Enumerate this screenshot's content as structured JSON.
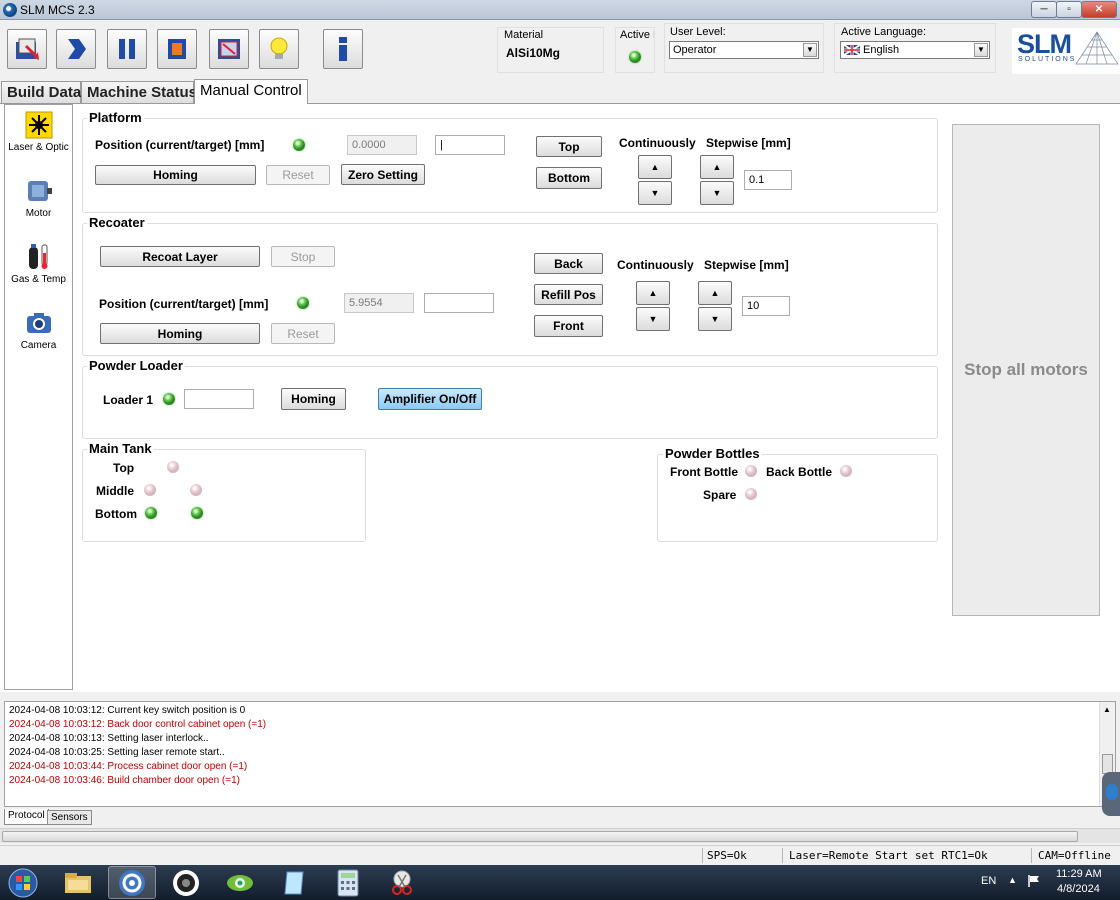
{
  "window": {
    "title": "SLM MCS 2.3",
    "minimize": "─",
    "maximize": "▫",
    "close": "✕"
  },
  "toolbar": {
    "buttons": [
      {
        "icon": "open-job-icon"
      },
      {
        "icon": "start-icon"
      },
      {
        "icon": "pause-icon"
      },
      {
        "icon": "stop-icon"
      },
      {
        "icon": "monitor-icon"
      },
      {
        "icon": "lightbulb-icon"
      },
      {
        "icon": "info-icon"
      }
    ],
    "material_label": "Material",
    "material_value": "AlSi10Mg",
    "active_l_label": "Active L",
    "user_level_label": "User Level:",
    "user_level_value": "Operator",
    "language_label": "Active Language:",
    "language_value": "English",
    "logo_text": "SLM",
    "logo_sub": "SOLUTIONS"
  },
  "tabs": [
    {
      "label": "Build Data"
    },
    {
      "label": "Machine Status"
    },
    {
      "label": "Manual Control"
    }
  ],
  "nav": [
    {
      "label": "Laser & Optic"
    },
    {
      "label": "Motor"
    },
    {
      "label": "Gas & Temp"
    },
    {
      "label": "Camera"
    }
  ],
  "platform": {
    "title": "Platform",
    "position_label": "Position (current/target) [mm]",
    "current": "0.0000",
    "target": "|",
    "homing": "Homing",
    "reset": "Reset",
    "zero": "Zero Setting",
    "top": "Top",
    "bottom": "Bottom",
    "continuously": "Continuously",
    "stepwise": "Stepwise [mm]",
    "step_value": "0.1"
  },
  "recoater": {
    "title": "Recoater",
    "recoat_layer": "Recoat Layer",
    "stop": "Stop",
    "position_label": "Position (current/target) [mm]",
    "current": "5.9554",
    "target": "",
    "homing": "Homing",
    "reset": "Reset",
    "back": "Back",
    "refill": "Refill Pos",
    "front": "Front",
    "continuously": "Continuously",
    "stepwise": "Stepwise [mm]",
    "step_value": "10"
  },
  "powder_loader": {
    "title": "Powder Loader",
    "loader_label": "Loader 1",
    "loader_value": "",
    "homing": "Homing",
    "amplifier": "Amplifier On/Off"
  },
  "main_tank": {
    "title": "Main Tank",
    "top": "Top",
    "middle": "Middle",
    "bottom": "Bottom"
  },
  "powder_bottles": {
    "title": "Powder Bottles",
    "front": "Front Bottle",
    "back": "Back Bottle",
    "spare": "Spare"
  },
  "stop_all": "Stop all motors",
  "log": [
    {
      "text": "2024-04-08 10:03:12: Current key switch position is 0",
      "level": "info"
    },
    {
      "text": "2024-04-08 10:03:12: Back door control cabinet open (=1)",
      "level": "error"
    },
    {
      "text": "2024-04-08 10:03:13: Setting laser interlock..",
      "level": "info"
    },
    {
      "text": "2024-04-08 10:03:25: Setting laser remote start..",
      "level": "info"
    },
    {
      "text": "2024-04-08 10:03:44: Process cabinet door open (=1)",
      "level": "error"
    },
    {
      "text": "2024-04-08 10:03:46: Build chamber door open (=1)",
      "level": "error"
    }
  ],
  "bottom_tabs": [
    {
      "label": "Protocol"
    },
    {
      "label": "Sensors"
    }
  ],
  "status": {
    "sps": "SPS=Ok",
    "laser": "Laser=Remote Start set RTC1=Ok",
    "cam": "CAM=Offline"
  },
  "taskbar": {
    "apps": [
      "start-orb-icon",
      "file-explorer-icon",
      "slm-mcs-icon",
      "camera-app-icon",
      "eye-app-icon",
      "notepad-app-icon",
      "calculator-icon",
      "snipping-tool-icon"
    ],
    "lang": "EN",
    "time": "11:29 AM",
    "date": "4/8/2024"
  },
  "colors": {
    "error": "#c00000",
    "led_green": "#3aa02c",
    "accent_blue": "#8ccaf2"
  }
}
